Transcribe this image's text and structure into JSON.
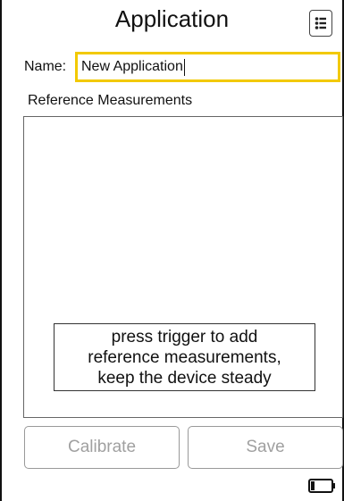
{
  "header": {
    "title": "Application",
    "menu_icon": "list-menu-icon"
  },
  "form": {
    "name_label": "Name:",
    "name_value": "New Application"
  },
  "reference": {
    "heading": "Reference Measurements",
    "hint_lines": [
      "press trigger to add",
      "reference measurements,",
      "keep the device steady"
    ]
  },
  "actions": {
    "calibrate_label": "Calibrate",
    "save_label": "Save"
  },
  "status": {
    "battery_icon": "battery-icon"
  },
  "colors": {
    "focus_border": "#f2c900",
    "disabled_text": "#a0a0a0"
  }
}
